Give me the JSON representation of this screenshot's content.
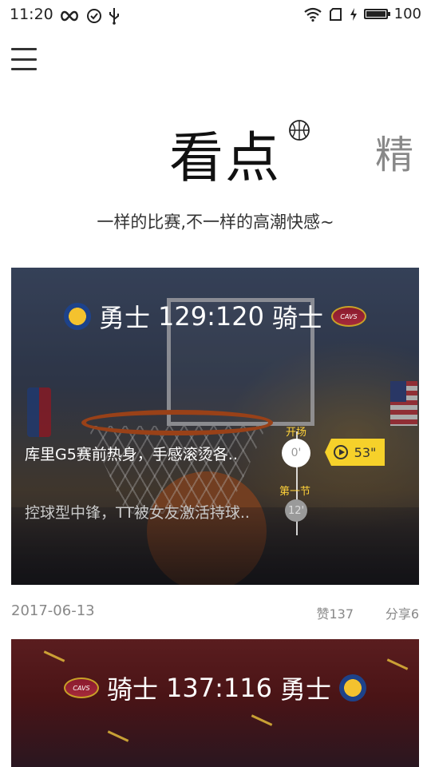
{
  "status_bar": {
    "time": "11:20",
    "battery": "100",
    "left_icons": [
      "infinity-icon",
      "check-circle-icon",
      "usb-icon"
    ],
    "right_icons": [
      "wifi-icon",
      "sim-icon",
      "charging-icon",
      "battery-icon"
    ]
  },
  "header": {
    "active_tab": "看点",
    "next_tab": "精",
    "subtitle": "一样的比赛,不一样的高潮快感~"
  },
  "cards": [
    {
      "team_left": "勇士",
      "score": "129:120",
      "team_right": "骑士",
      "highlights": [
        {
          "text": "库里G5赛前热身，手感滚烫各..",
          "phase": "开场",
          "minute": "0'",
          "duration": "53\"",
          "active": true
        },
        {
          "text": "控球型中锋，TT被女友激活持球..",
          "phase": "第一节",
          "minute": "12'",
          "active": false
        }
      ],
      "date": "2017-06-13",
      "likes": "赞137",
      "shares": "分享6"
    },
    {
      "team_left": "骑士",
      "score": "137:116",
      "team_right": "勇士"
    }
  ],
  "colors": {
    "accent_yellow": "#f6d12a",
    "text_muted": "#888888",
    "highlight_label": "#ffd23a"
  }
}
